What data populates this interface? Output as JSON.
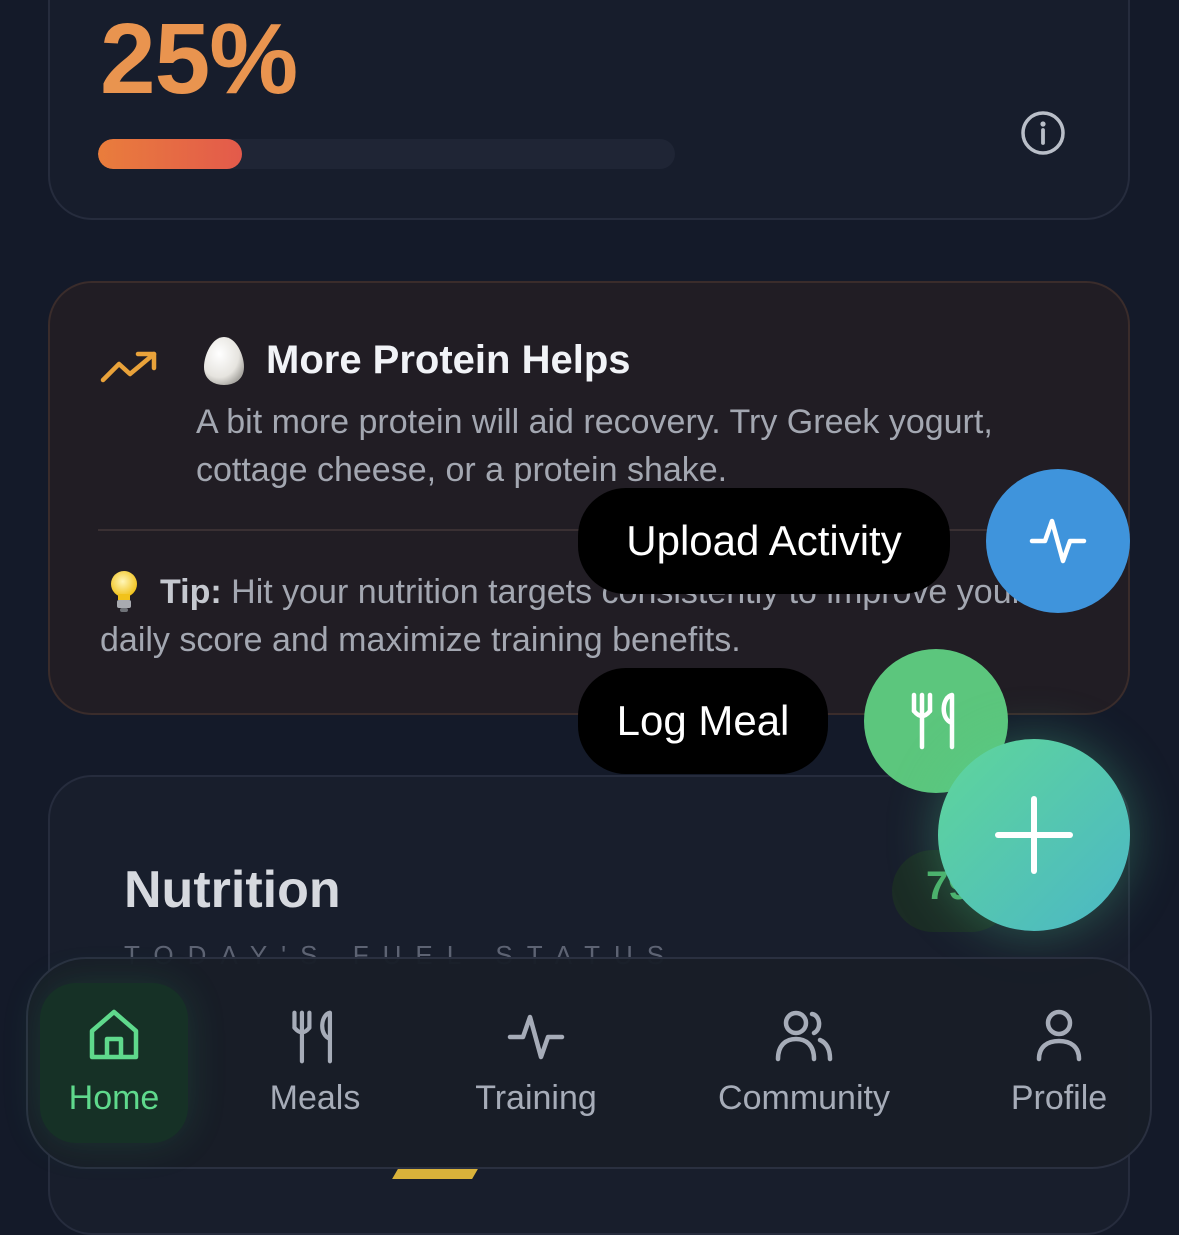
{
  "progress_card": {
    "percent_text": "25%",
    "progress_fraction": 0.25
  },
  "insight_card": {
    "emoji": "🥚",
    "title": "More Protein Helps",
    "body": "A bit more protein will aid recovery. Try Greek yogurt, cottage cheese, or a protein shake.",
    "tip_label": "Tip:",
    "tip_text": " Hit your nutrition targets consistently to improve your daily score and maximize training benefits."
  },
  "nutrition_card": {
    "title": "Nutrition",
    "subtitle": "TODAY'S FUEL STATUS",
    "score": "79"
  },
  "action_menu": {
    "upload_activity_label": "Upload Activity",
    "log_meal_label": "Log Meal"
  },
  "bottom_nav": {
    "items": [
      {
        "label": "Home",
        "icon": "home-icon",
        "active": true
      },
      {
        "label": "Meals",
        "icon": "fork-knife-icon"
      },
      {
        "label": "Training",
        "icon": "activity-icon"
      },
      {
        "label": "Community",
        "icon": "users-icon"
      },
      {
        "label": "Profile",
        "icon": "user-icon"
      }
    ]
  },
  "colors": {
    "background": "#141a29",
    "accent_orange": "#e9944f",
    "activity_blue": "#3f94dc",
    "meal_green": "#5cc67d",
    "nav_active": "#5fd98c"
  }
}
